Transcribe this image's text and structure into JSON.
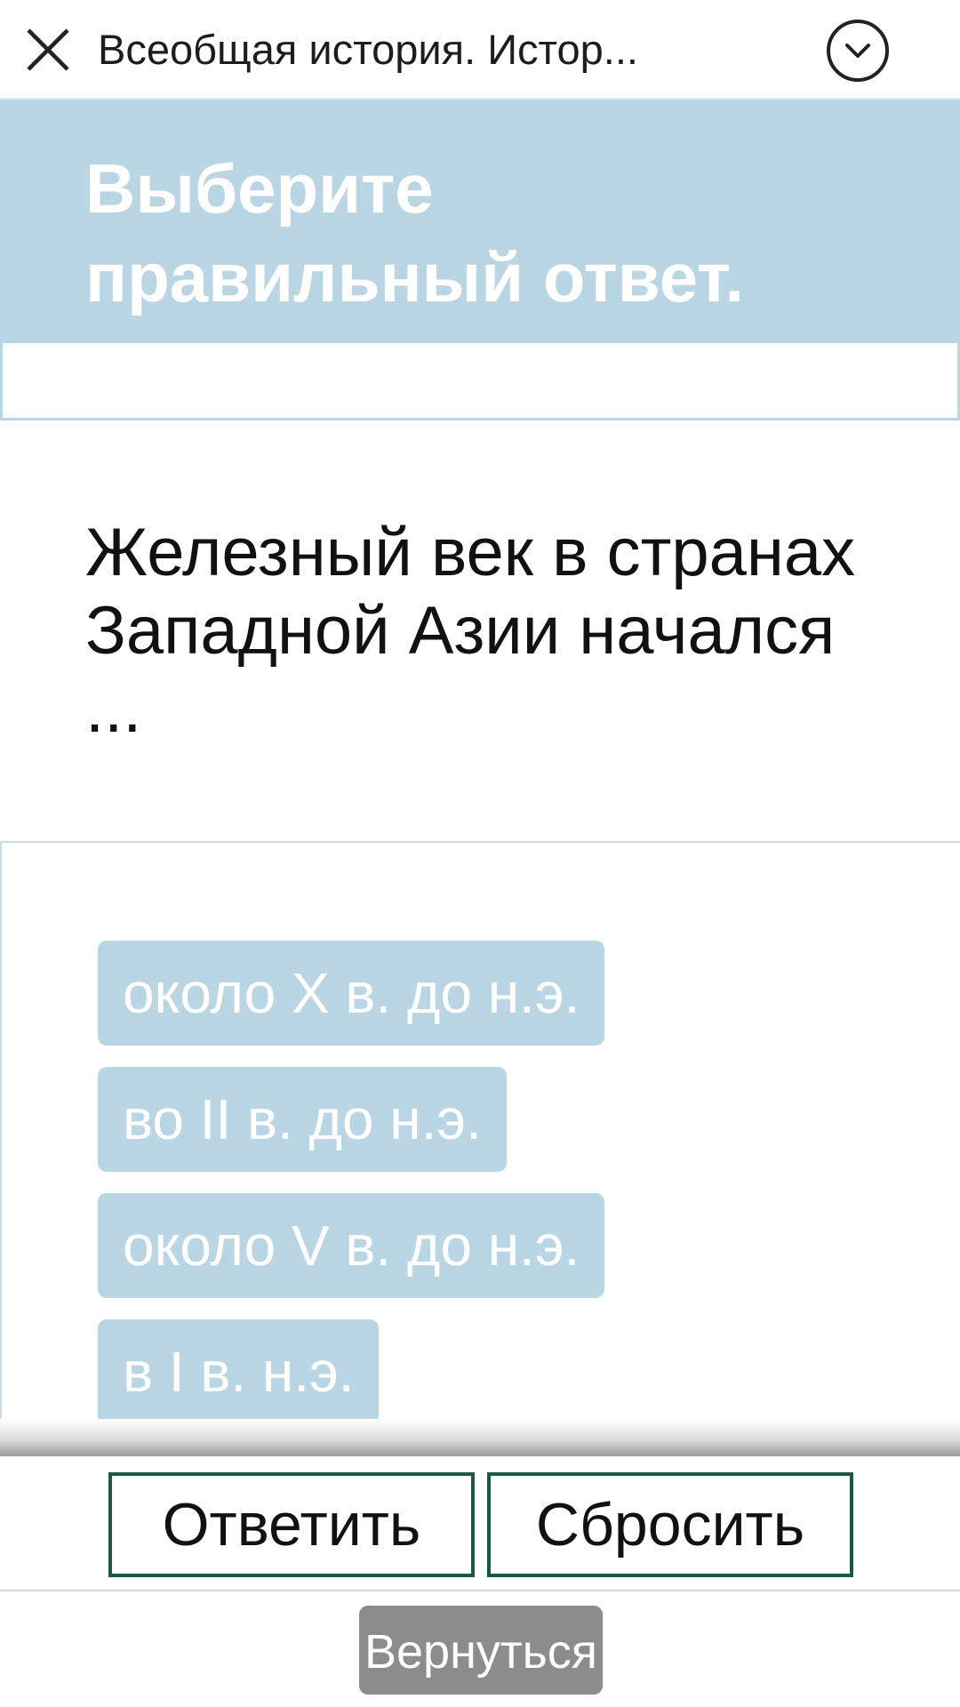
{
  "header": {
    "title": "Всеобщая история. Истор...",
    "close_icon": "close-icon",
    "menu_icon": "chevron-down-circle-icon"
  },
  "banner": {
    "title": "Выберите правильный ответ."
  },
  "question": {
    "text": "Железный век в странах Западной Азии начался ..."
  },
  "options": [
    {
      "label": "около X в. до н.э."
    },
    {
      "label": "во II в. до н.э."
    },
    {
      "label": "около V в. до н.э."
    },
    {
      "label": "в I в. н.э."
    }
  ],
  "actions": {
    "answer_label": "Ответить",
    "reset_label": "Сбросить",
    "back_label": "Вернуться"
  },
  "colors": {
    "accent": "#bad6e4",
    "button_border": "#1f5747",
    "back_button": "#8c8c8c"
  }
}
